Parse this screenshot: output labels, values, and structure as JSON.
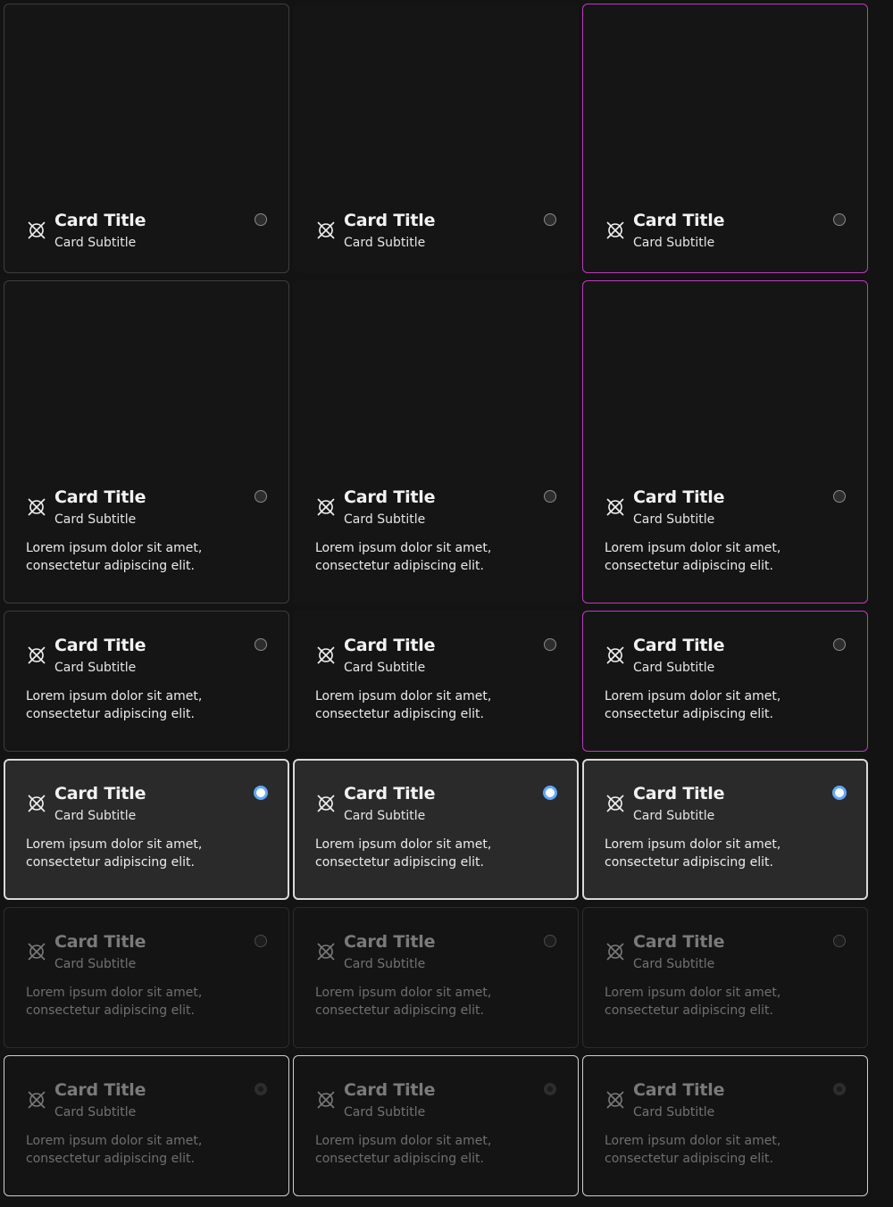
{
  "card": {
    "title": "Card Title",
    "subtitle": "Card Subtitle",
    "body": "Lorem ipsum dolor sit amet, consectetur adipiscing elit."
  },
  "icon": "no-image-icon",
  "colors": {
    "accent_border": "#c03ac0",
    "radio_selected": "#5ea8ff",
    "background": "#131313"
  },
  "rows": [
    {
      "variant": "media",
      "states": [
        "outlined",
        "plain",
        "outlined-accent"
      ],
      "radio": "unselected"
    },
    {
      "variant": "media-with-body",
      "states": [
        "outlined",
        "plain",
        "outlined-accent"
      ],
      "radio": "unselected"
    },
    {
      "variant": "body",
      "states": [
        "outlined",
        "outlined",
        "outlined-accent"
      ],
      "radio": "unselected"
    },
    {
      "variant": "body",
      "states": [
        "selected",
        "selected",
        "selected"
      ],
      "radio": "selected"
    },
    {
      "variant": "body",
      "states": [
        "disabled",
        "disabled",
        "disabled"
      ],
      "radio": "disabled"
    },
    {
      "variant": "body",
      "states": [
        "disabled-selected",
        "disabled-selected",
        "disabled-selected"
      ],
      "radio": "disabled-selected"
    }
  ]
}
